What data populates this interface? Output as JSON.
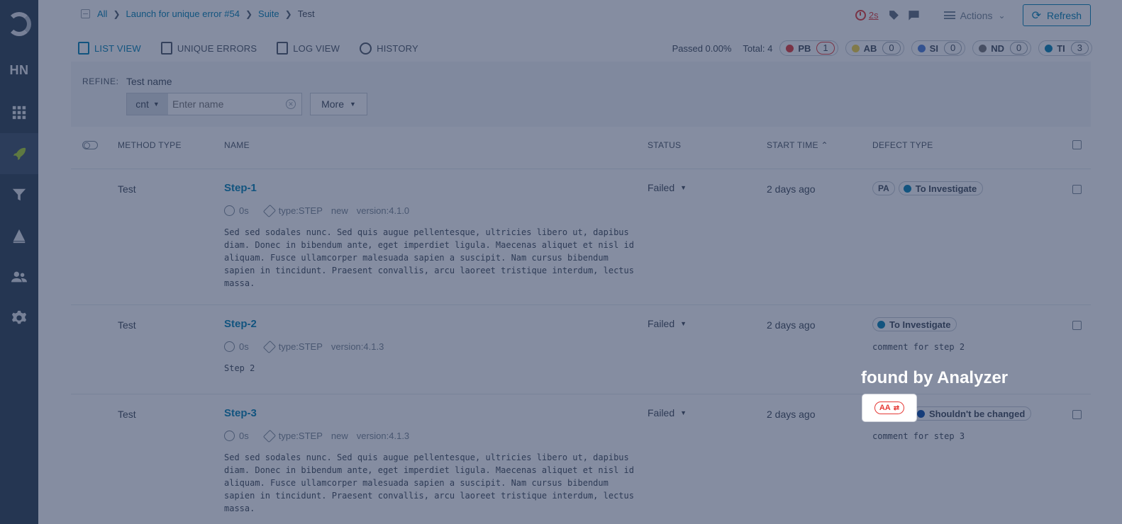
{
  "sidebar": {
    "project": "HN"
  },
  "breadcrumb": {
    "items": [
      "All",
      "Launch for unique error #54",
      "Suite"
    ],
    "current": "Test"
  },
  "header": {
    "timer": "2s",
    "actions_label": "Actions",
    "refresh_label": "Refresh"
  },
  "views": [
    "LIST VIEW",
    "UNIQUE ERRORS",
    "LOG VIEW",
    "HISTORY"
  ],
  "stats": {
    "passed": "Passed 0.00%",
    "total": "Total: 4",
    "chips": [
      {
        "label": "PB",
        "count": "1",
        "color": "#e53935"
      },
      {
        "label": "AB",
        "count": "0",
        "color": "#f7d63e"
      },
      {
        "label": "SI",
        "count": "0",
        "color": "#4b7dd9"
      },
      {
        "label": "ND",
        "count": "0",
        "color": "#777777"
      },
      {
        "label": "TI",
        "count": "3",
        "color": "#0080b3"
      }
    ]
  },
  "refine": {
    "label": "REFINE:",
    "filter_name": "Test name",
    "condition": "cnt",
    "placeholder": "Enter name",
    "more_label": "More"
  },
  "columns": {
    "method": "METHOD TYPE",
    "name": "NAME",
    "status": "STATUS",
    "start": "START TIME",
    "defect": "DEFECT TYPE"
  },
  "rows": [
    {
      "method": "Test",
      "name": "Step-1",
      "duration": "0s",
      "attributes": [
        "type:STEP",
        "new",
        "version:4.1.0"
      ],
      "description": "Sed sed sodales nunc. Sed quis augue pellentesque, ultricies libero ut, dapibus diam. Donec in bibendum ante, eget imperdiet ligula. Maecenas aliquet et nisl id aliquam. Fusce ullamcorper malesuada sapien a suscipit. Nam cursus bibendum sapien in tincidunt. Praesent convallis, arcu laoreet tristique interdum, lectus massa.",
      "status": "Failed",
      "start": "2 days ago",
      "defect_badge": "PA",
      "defect": "To Investigate",
      "defect_color": "#0080b3",
      "comment": ""
    },
    {
      "method": "Test",
      "name": "Step-2",
      "duration": "0s",
      "attributes": [
        "type:STEP",
        "version:4.1.3"
      ],
      "description": "Step 2",
      "status": "Failed",
      "start": "2 days ago",
      "defect_badge": "",
      "defect": "To Investigate",
      "defect_color": "#0080b3",
      "comment": "comment for step 2"
    },
    {
      "method": "Test",
      "name": "Step-3",
      "duration": "0s",
      "attributes": [
        "type:STEP",
        "new",
        "version:4.1.3"
      ],
      "description": "Sed sed sodales nunc. Sed quis augue pellentesque, ultricies libero ut, dapibus diam. Donec in bibendum ante, eget imperdiet ligula. Maecenas aliquet et nisl id aliquam. Fusce ullamcorper malesuada sapien a suscipit. Nam cursus bibendum sapien in tincidunt. Praesent convallis, arcu laoreet tristique interdum, lectus massa.",
      "status": "Failed",
      "start": "2 days ago",
      "defect_badge": "AA",
      "defect": "Shouldn't be changed",
      "defect_color": "#0a4fa8",
      "comment": "comment for step 3"
    }
  ],
  "tour": {
    "text": "found by Analyzer"
  }
}
